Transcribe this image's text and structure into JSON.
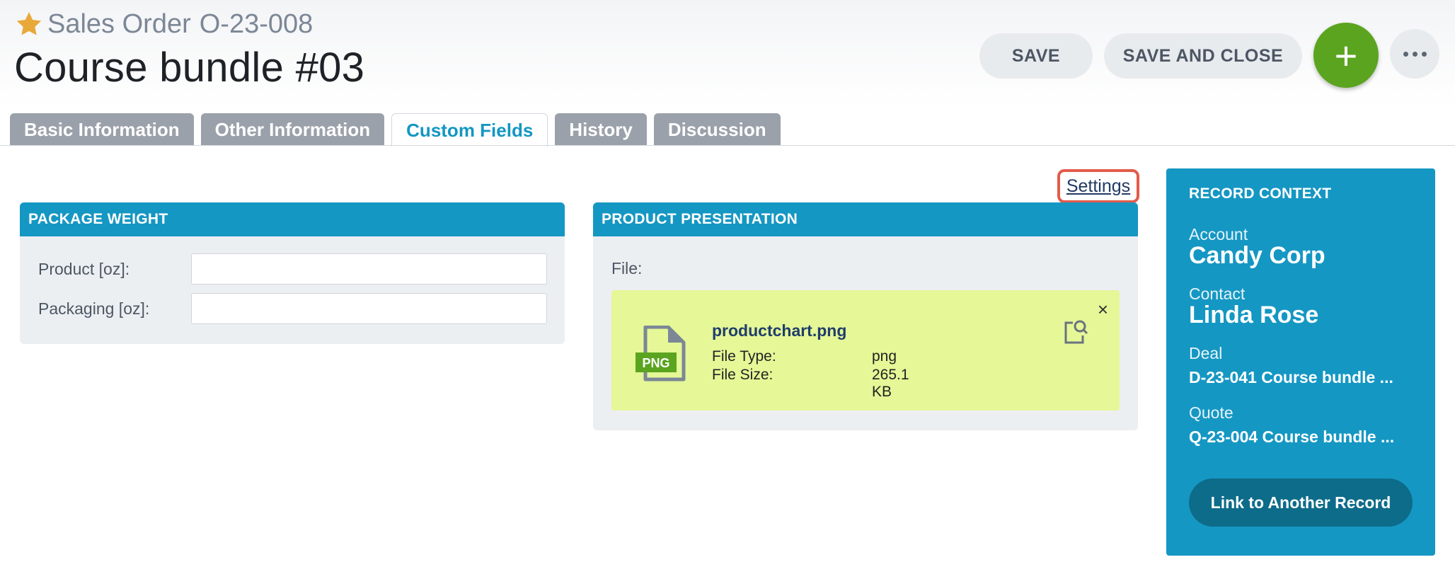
{
  "header": {
    "entity_type": "Sales Order",
    "record_number": "O-23-008",
    "title": "Course bundle #03"
  },
  "toolbar": {
    "save_label": "SAVE",
    "save_close_label": "SAVE AND CLOSE",
    "add_label": "+",
    "more_icon": "more-horizontal-icon"
  },
  "tabs": [
    {
      "label": "Basic Information",
      "active": false
    },
    {
      "label": "Other Information",
      "active": false
    },
    {
      "label": "Custom Fields",
      "active": true
    },
    {
      "label": "History",
      "active": false
    },
    {
      "label": "Discussion",
      "active": false
    }
  ],
  "settings_link": "Settings",
  "package_weight": {
    "title": "PACKAGE WEIGHT",
    "fields": [
      {
        "label": "Product [oz]:",
        "value": ""
      },
      {
        "label": "Packaging [oz]:",
        "value": ""
      }
    ]
  },
  "product_presentation": {
    "title": "PRODUCT PRESENTATION",
    "file_label": "File:",
    "file": {
      "badge": "PNG",
      "name": "productchart.png",
      "type_label": "File Type:",
      "type_value": "png",
      "size_label": "File Size:",
      "size_value": "265.1 KB",
      "close_label": "×"
    }
  },
  "record_context": {
    "title": "RECORD CONTEXT",
    "account_label": "Account",
    "account_value": "Candy Corp",
    "contact_label": "Contact",
    "contact_value": "Linda Rose",
    "deal_label": "Deal",
    "deal_value": "D-23-041 Course bundle ...",
    "quote_label": "Quote",
    "quote_value": "Q-23-004 Course bundle ...",
    "link_button": "Link to Another Record"
  },
  "colors": {
    "accent": "#1597c3",
    "add_button": "#5ba41f",
    "file_card": "#e5f797",
    "highlight": "#e25c4a",
    "star": "#e9a83a"
  }
}
